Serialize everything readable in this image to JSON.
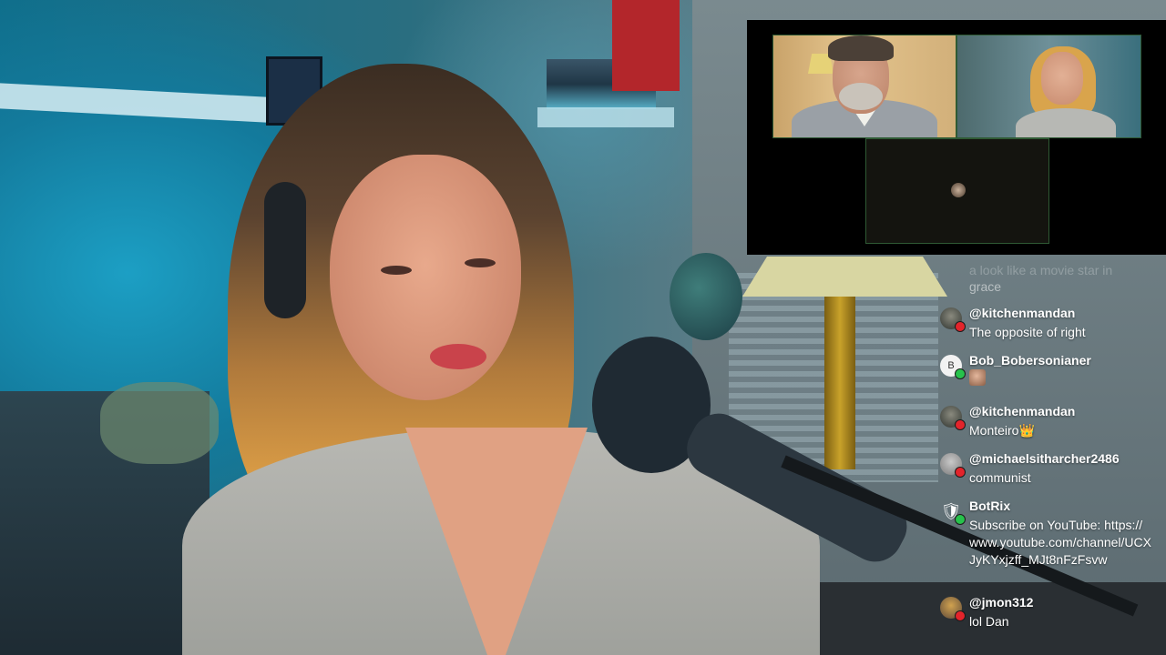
{
  "stream": {
    "chat": {
      "clipped_text": {
        "line1": "a look like a movie star in",
        "line2": "grace"
      },
      "messages": [
        {
          "username": "@kitchenmandan",
          "platform": "youtube",
          "text": "The opposite of right"
        },
        {
          "username": "Bob_Bobersonianer",
          "platform": "kick",
          "avatar_letter": "B",
          "text": "",
          "emote": "face-emote"
        },
        {
          "username": "@kitchenmandan",
          "platform": "youtube",
          "text": "Monteiro👑"
        },
        {
          "username": "@michaelsitharcher2486",
          "platform": "youtube",
          "text": "communist"
        },
        {
          "username": "BotRix",
          "platform": "kick",
          "avatar_icon": "🛡",
          "text": "Subscribe on YouTube: https://www.youtube.com/channel/UCXJyKYxjzff_MJt8nFzFsvw"
        },
        {
          "username": "@jmon312",
          "platform": "youtube",
          "text": "lol Dan"
        }
      ]
    },
    "call": {
      "participants": [
        "man-with-headset",
        "woman-with-headset",
        "camera-off"
      ]
    },
    "colors": {
      "youtube_badge": "#e3242b",
      "kick_badge": "#27c24c",
      "tile_border": "#2f5a34",
      "chat_text": "#ffffff"
    }
  }
}
